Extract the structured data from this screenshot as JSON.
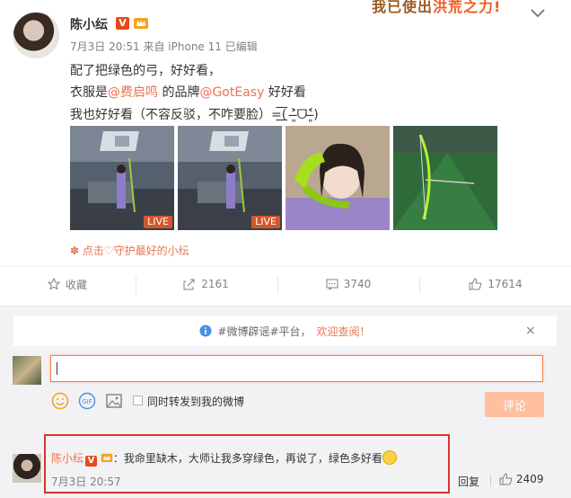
{
  "banner": {
    "prefix": "我已使出",
    "highlight": "洪荒之力",
    "suffix": "!"
  },
  "post": {
    "author": "陈小纭",
    "verified_badge": "V",
    "meta": "7月3日 20:51 来自 iPhone 11   已编辑",
    "line1": "配了把绿色的弓，好好看，",
    "line2_prefix": "衣服是",
    "line2_mention1": "@费启鸣",
    "line2_middle": " 的品牌",
    "line2_mention2": "@GotEasy",
    "line2_suffix": " 好好看",
    "line3": "我也好好看（不容反驳，不咋要脸）=͟͟͞͞( ˃̶͈̀ᗜ˂̶͈́)",
    "photos": [
      {
        "kind": "archery-indoor",
        "live_label": "LIVE"
      },
      {
        "kind": "archery-indoor",
        "live_label": "LIVE"
      },
      {
        "kind": "selfie-bow"
      },
      {
        "kind": "bow-on-grass"
      }
    ],
    "promo": "点击♡守护最好的小纭"
  },
  "actions": {
    "favorite": "收藏",
    "repost_count": "2161",
    "comment_count": "3740",
    "like_count": "17614"
  },
  "comment_box": {
    "notice_text": "#微博辟谣#平台，",
    "notice_link": "欢迎查阅！",
    "close_symbol": "×",
    "also_repost_label": "同时转发到我的微博",
    "submit_label": "评论",
    "input_value": ""
  },
  "top_comment": {
    "author": "陈小纭",
    "badge": "V",
    "text": "：我命里缺木，大师让我多穿绿色，再说了，绿色多好看",
    "time": "7月3日 20:57",
    "reply_label": "回复",
    "like_count": "2409"
  },
  "colors": {
    "accent": "#eb7350",
    "highlight_border": "#d9342b",
    "panel_bg": "#f2f2f5"
  }
}
